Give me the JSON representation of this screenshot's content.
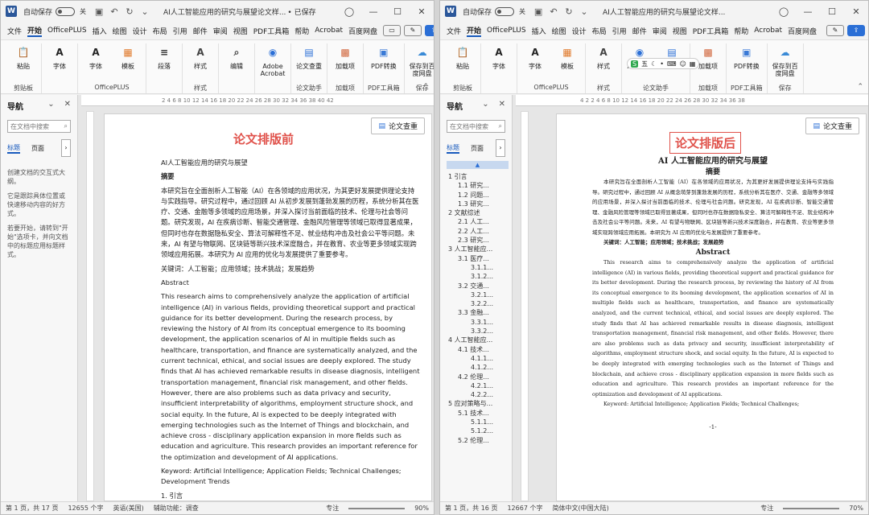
{
  "windows": {
    "left": {
      "titlebar": {
        "autosave": "自动保存",
        "toggle_state": "关",
        "title": "AI人工智能应用的研究与展望论文样...",
        "saved": "• 已保存"
      },
      "menu": [
        "文件",
        "开始",
        "OfficePLUS",
        "插入",
        "绘图",
        "设计",
        "布局",
        "引用",
        "邮件",
        "审阅",
        "视图",
        "PDF工具箱",
        "帮助",
        "Acrobat",
        "百度网盘"
      ],
      "ribbon": [
        {
          "buttons": [
            {
              "label": "粘贴",
              "icon": "paste-icon"
            }
          ],
          "group": "剪贴板"
        },
        {
          "buttons": [
            {
              "label": "字体",
              "icon": "font-icon"
            }
          ],
          "group": ""
        },
        {
          "buttons": [
            {
              "label": "字体",
              "icon": "font-icon"
            },
            {
              "label": "模板",
              "icon": "template-icon"
            }
          ],
          "group": "OfficePLUS"
        },
        {
          "buttons": [
            {
              "label": "段落",
              "icon": "paragraph-icon"
            }
          ],
          "group": ""
        },
        {
          "buttons": [
            {
              "label": "样式",
              "icon": "styles-icon"
            }
          ],
          "group": "样式"
        },
        {
          "buttons": [
            {
              "label": "编辑",
              "icon": "edit-icon"
            }
          ],
          "group": ""
        },
        {
          "buttons": [
            {
              "label": "Adobe Acrobat",
              "icon": "adobe-icon"
            }
          ],
          "group": ""
        },
        {
          "buttons": [
            {
              "label": "论文查重",
              "icon": "check-icon"
            }
          ],
          "group": "论文助手"
        },
        {
          "buttons": [
            {
              "label": "加载项",
              "icon": "addin-icon"
            }
          ],
          "group": "加载项"
        },
        {
          "buttons": [
            {
              "label": "PDF转换",
              "icon": "pdf-icon"
            }
          ],
          "group": "PDF工具箱"
        },
        {
          "buttons": [
            {
              "label": "保存到百度网盘",
              "icon": "cloud-icon"
            }
          ],
          "group": "保存"
        }
      ],
      "nav": {
        "title": "导航",
        "search": "在文档中搜索",
        "tabs": [
          "标题",
          "页面"
        ],
        "hints": [
          "创建文档的交互式大纲。",
          "它是跟踪具体位置或快速移动内容的好方式。",
          "若要开始，请转到\"开始\"选项卡，并向文档中的标题应用标题样式。"
        ]
      },
      "ruler": "2   4   6   8   10  12  14  16  18  20  22  24  26  28  30  32  34  36  38  40  42",
      "check_button": "论文查重",
      "stamp": "论文排版前",
      "doc": {
        "title": "AI人工智能应用的研究与展望",
        "abstract_label": "摘要",
        "abstract": "本研究旨在全面剖析人工智能（AI）在各领域的应用状况，为其更好发展提供理论支持与实践指导。研究过程中，通过回顾 AI 从初步发展到蓬勃发展的历程，系统分析其在医疗、交通、金融等多领域的应用场景，并深入探讨当前面临的技术、伦理与社会等问题。研究发现，AI 在疾病诊断、智能交通管理、金融风险管理等领域已取得显著成果，但同时也存在数据隐私安全、算法可解释性不足、就业结构冲击及社会公平等问题。未来，AI 有望与物联网、区块链等新兴技术深度融合，并在教育、农业等更多领域实现跨领域应用拓展。本研究为 AI 应用的优化与发展提供了重要参考。",
        "keywords": "关键词：人工智能；应用领域；技术挑战；发展趋势",
        "abstract_en_label": "Abstract",
        "abstract_en": "This research aims to comprehensively analyze the application of artificial intelligence (AI) in various fields, providing theoretical support and practical guidance for its better development. During the research process, by reviewing the history of AI from its conceptual emergence to its booming development, the application scenarios of AI in multiple fields such as healthcare, transportation, and finance are systematically analyzed, and the current technical, ethical, and social issues are deeply explored. The study finds that AI has achieved remarkable results in disease diagnosis, intelligent transportation management, financial risk management, and other fields. However, there are also problems such as data privacy and security, insufficient interpretability of algorithms, employment structure shock, and social equity. In the future, AI is expected to be deeply integrated with emerging technologies such as the Internet of Things and blockchain, and achieve cross - disciplinary application expansion in more fields such as education and agriculture. This research provides an important reference for the optimization and development of AI applications.",
        "keywords_en": "Keyword:  Artificial Intelligence; Application Fields; Technical Challenges; Development Trends",
        "heading1": "1. 引言"
      },
      "status": [
        "第 1 页，共 17 页",
        "12655 个字",
        "英语(美国)",
        "辅助功能：调查",
        "专注",
        "90%"
      ]
    },
    "right": {
      "titlebar": {
        "autosave": "自动保存",
        "toggle_state": "关",
        "title": "AI人工智能应用的研究与展望论文样..."
      },
      "menu": [
        "文件",
        "开始",
        "OfficePLUS",
        "插入",
        "绘图",
        "设计",
        "布局",
        "引用",
        "邮件",
        "审阅",
        "视图",
        "PDF工具箱",
        "帮助",
        "Acrobat",
        "百度网盘"
      ],
      "ribbon": [
        {
          "buttons": [
            {
              "label": "粘贴",
              "icon": "paste-icon"
            }
          ],
          "group": "剪贴板"
        },
        {
          "buttons": [
            {
              "label": "字体",
              "icon": "font-icon"
            }
          ],
          "group": ""
        },
        {
          "buttons": [
            {
              "label": "字体",
              "icon": "font-icon"
            },
            {
              "label": "模板",
              "icon": "template-icon"
            }
          ],
          "group": "OfficePLUS"
        },
        {
          "buttons": [
            {
              "label": "样式",
              "icon": "styles-icon"
            }
          ],
          "group": "样式"
        },
        {
          "buttons": [
            {
              "label": "Acrobat",
              "icon": "adobe-icon"
            },
            {
              "label": "论文查重",
              "icon": "check-icon"
            }
          ],
          "group": "论文助手"
        },
        {
          "buttons": [
            {
              "label": "加载项",
              "icon": "addin-icon"
            }
          ],
          "group": "加载项"
        },
        {
          "buttons": [
            {
              "label": "PDF转换",
              "icon": "pdf-icon"
            }
          ],
          "group": "PDF工具箱"
        },
        {
          "buttons": [
            {
              "label": "保存到百度网盘",
              "icon": "cloud-icon"
            }
          ],
          "group": "保存"
        }
      ],
      "nav": {
        "title": "导航",
        "search": "在文档中搜索",
        "tabs": [
          "标题",
          "页面"
        ],
        "outline": [
          "1 引言",
          "1.1 研究...",
          "1.2 问题...",
          "1.3 研究...",
          "2 文献综述",
          "2.1 人工...",
          "2.2 人工...",
          "2.3 研究...",
          "3 人工智能应...",
          "3.1 医疗...",
          "3.1.1...",
          "3.1.2...",
          "3.2 交通...",
          "3.2.1...",
          "3.2.2...",
          "3.3 金融...",
          "3.3.1...",
          "3.3.2...",
          "4 人工智能应...",
          "4.1 技术...",
          "4.1.1...",
          "4.1.2...",
          "4.2 伦理...",
          "4.2.1...",
          "4.2.2...",
          "5 应对策略与...",
          "5.1 技术...",
          "5.1.1...",
          "5.1.2...",
          "5.2 伦理..."
        ]
      },
      "ruler": "4   2       2   4   6   8   10  12  14  16  18  20  22  24  26  28  30  32  34  36  38",
      "check_button": "论文查重",
      "stamp": "论文排版后",
      "doc": {
        "title": "AI 人工智能应用的研究与展望",
        "abstract_label": "摘要",
        "abstract": "本研究旨在全面剖析人工智能（AI）在各领域的应用状况，为其更好发展提供理论支持与实践指导。研究过程中，通过回顾 AI 从概念萌芽到蓬勃发展的历程，系统分析其在医疗、交通、金融等多领域的应用场景，并深入探讨当前面临的技术、伦理与社会问题。研究发现，AI 在疾病诊断、智能交通管理、金融风险管理等领域已取得显著成果，但同时也存在数据隐私安全、算法可解释性不足、就业结构冲击及社会公平等问题。未来，AI 有望与物联网、区块链等新兴技术深度融合，并在教育、农业等更多领域实现跨领域应用拓展。本研究为 AI 应用的优化与发展提供了重要参考。",
        "keywords": "关键词：人工智能；应用领域；技术挑战；发展趋势",
        "abstract_en_label": "Abstract",
        "abstract_en": "This research aims to comprehensively analyze the application of artificial intelligence (AI) in various fields, providing theoretical support and practical guidance for its better development. During the research process, by reviewing the history of AI from its conceptual emergence to its booming development, the application scenarios of AI in multiple fields such as healthcare, transportation, and finance are systematically analyzed, and the current technical, ethical, and social issues are deeply explored. The study finds that AI has achieved remarkable results in disease diagnosis, intelligent transportation management, financial risk management, and other fields. However, there are also problems such as data privacy and security, insufficient interpretability of algorithms, employment structure shock, and social equity. In the future, AI is expected to be deeply integrated with emerging technologies such as the Internet of Things and blockchain, and achieve cross - disciplinary application expansion in more fields such as education and agriculture. This research provides an important reference for the optimization and development of AI applications.",
        "keywords_en": "Keyword:    Artificial Intelligence;  Application Fields;  Technical Challenges;",
        "page_mark": "-1-"
      },
      "status": [
        "第 1 页，共 16 页",
        "12667 个字",
        "简体中文(中国大陆)",
        "专注",
        "70%"
      ]
    }
  },
  "colors": {
    "accent": "#185abd",
    "stamp": "#e0524b",
    "word_blue": "#2b579a"
  }
}
